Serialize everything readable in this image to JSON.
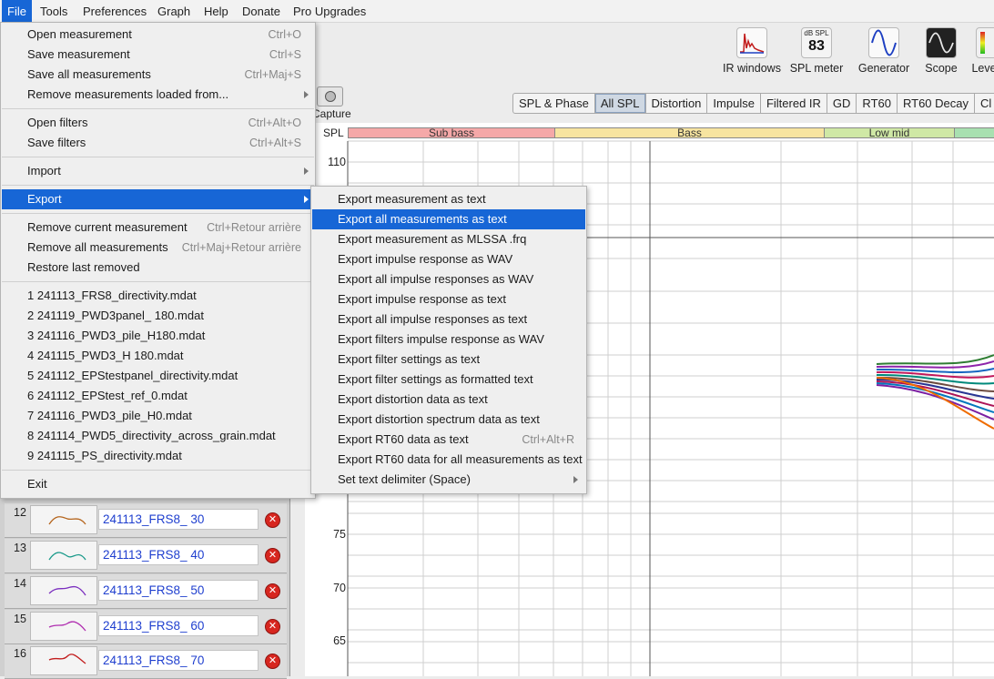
{
  "menubar": [
    {
      "label": "File",
      "active": true
    },
    {
      "label": "Tools"
    },
    {
      "label": "Preferences"
    },
    {
      "label": "Graph"
    },
    {
      "label": "Help"
    },
    {
      "label": "Donate"
    },
    {
      "label": "Pro Upgrades"
    }
  ],
  "toolbar": {
    "ir_windows": "IR windows",
    "spl_meter": "SPL meter",
    "spl_meter_unit": "dB SPL",
    "spl_meter_value": "83",
    "generator": "Generator",
    "scope": "Scope",
    "levels": "Leve",
    "capture": "Capture"
  },
  "tabs": [
    "SPL & Phase",
    "All SPL",
    "Distortion",
    "Impulse",
    "Filtered IR",
    "GD",
    "RT60",
    "RT60 Decay",
    "Cl"
  ],
  "graph": {
    "spl_label": "SPL",
    "bands": [
      "Sub bass",
      "Bass",
      "Low mid",
      ""
    ],
    "y_ticks": [
      "110",
      "75",
      "70",
      "65"
    ]
  },
  "file_menu": {
    "open_measurement": {
      "label": "Open measurement",
      "shortcut": "Ctrl+O"
    },
    "save_measurement": {
      "label": "Save measurement",
      "shortcut": "Ctrl+S"
    },
    "save_all": {
      "label": "Save all measurements",
      "shortcut": "Ctrl+Maj+S"
    },
    "remove_loaded_from": {
      "label": "Remove measurements loaded from..."
    },
    "open_filters": {
      "label": "Open filters",
      "shortcut": "Ctrl+Alt+O"
    },
    "save_filters": {
      "label": "Save filters",
      "shortcut": "Ctrl+Alt+S"
    },
    "import": {
      "label": "Import"
    },
    "export": {
      "label": "Export"
    },
    "remove_current": {
      "label": "Remove current measurement",
      "shortcut": "Ctrl+Retour arrière"
    },
    "remove_all": {
      "label": "Remove all measurements",
      "shortcut": "Ctrl+Maj+Retour arrière"
    },
    "restore_last": {
      "label": "Restore last removed"
    },
    "recent": [
      "1 241113_FRS8_directivity.mdat",
      "2 241119_PWD3panel_ 180.mdat",
      "3 241116_PWD3_pile_H180.mdat",
      "4 241115_PWD3_H 180.mdat",
      "5 241112_EPStestpanel_directivity.mdat",
      "6 241112_EPStest_ref_0.mdat",
      "7 241116_PWD3_pile_H0.mdat",
      "8 241114_PWD5_directivity_across_grain.mdat",
      "9 241115_PS_directivity.mdat"
    ],
    "exit": {
      "label": "Exit"
    }
  },
  "export_menu": [
    {
      "label": "Export measurement as text"
    },
    {
      "label": "Export all measurements as text",
      "active": true
    },
    {
      "label": "Export measurement as MLSSA .frq"
    },
    {
      "label": "Export impulse response as WAV"
    },
    {
      "label": "Export all impulse responses as WAV"
    },
    {
      "label": "Export impulse response as text"
    },
    {
      "label": "Export all impulse responses as text"
    },
    {
      "label": "Export filters impulse response as WAV"
    },
    {
      "label": "Export filter settings as text"
    },
    {
      "label": "Export filter settings as formatted text"
    },
    {
      "label": "Export distortion data as text"
    },
    {
      "label": "Export distortion spectrum data as text"
    },
    {
      "label": "Export RT60 data as text",
      "shortcut": "Ctrl+Alt+R"
    },
    {
      "label": "Export RT60 data for all measurements as text"
    },
    {
      "label": "Set text delimiter (Space)",
      "submenu": true
    }
  ],
  "measurements": [
    {
      "num": "12",
      "name": "241113_FRS8_ 30",
      "color": "#b5651d"
    },
    {
      "num": "13",
      "name": "241113_FRS8_ 40",
      "color": "#1a9a8a"
    },
    {
      "num": "14",
      "name": "241113_FRS8_ 50",
      "color": "#7b2fbf"
    },
    {
      "num": "15",
      "name": "241113_FRS8_ 60",
      "color": "#b02fb0"
    },
    {
      "num": "16",
      "name": "241113_FRS8_ 70",
      "color": "#c21d1d"
    }
  ],
  "colors": {
    "accent": "#1766d6",
    "delete": "#d7261f",
    "measurement_name": "#1f3fcf"
  }
}
